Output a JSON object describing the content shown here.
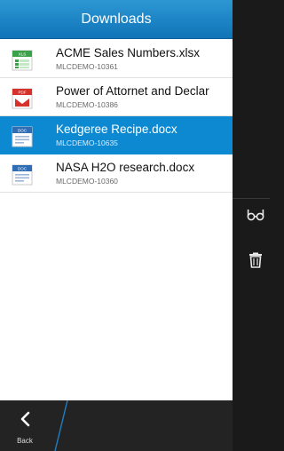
{
  "header": {
    "title": "Downloads"
  },
  "files": [
    {
      "name": "ACME Sales Numbers.xlsx",
      "id": "MLCDEMO-10361",
      "type_label": "XLS",
      "icon": "xlsx-document-icon",
      "color": "#3aa34a",
      "selected": false
    },
    {
      "name": "Power of Attornet and Declar",
      "id": "MLCDEMO-10386",
      "type_label": "PDF",
      "icon": "pdf-document-icon",
      "color": "#d6322c",
      "selected": false
    },
    {
      "name": "Kedgeree Recipe.docx",
      "id": "MLCDEMO-10635",
      "type_label": "DOC",
      "icon": "docx-document-icon",
      "color": "#2f6db5",
      "selected": true
    },
    {
      "name": "NASA H2O research.docx",
      "id": "MLCDEMO-10360",
      "type_label": "DOC",
      "icon": "docx-document-icon",
      "color": "#2f6db5",
      "selected": false
    }
  ],
  "footer": {
    "back_label": "Back"
  },
  "actions": [
    {
      "icon": "read-glasses-icon"
    },
    {
      "icon": "trash-icon"
    }
  ],
  "colors": {
    "accent": "#0d89d2",
    "titlebar": "#1a86c8"
  }
}
